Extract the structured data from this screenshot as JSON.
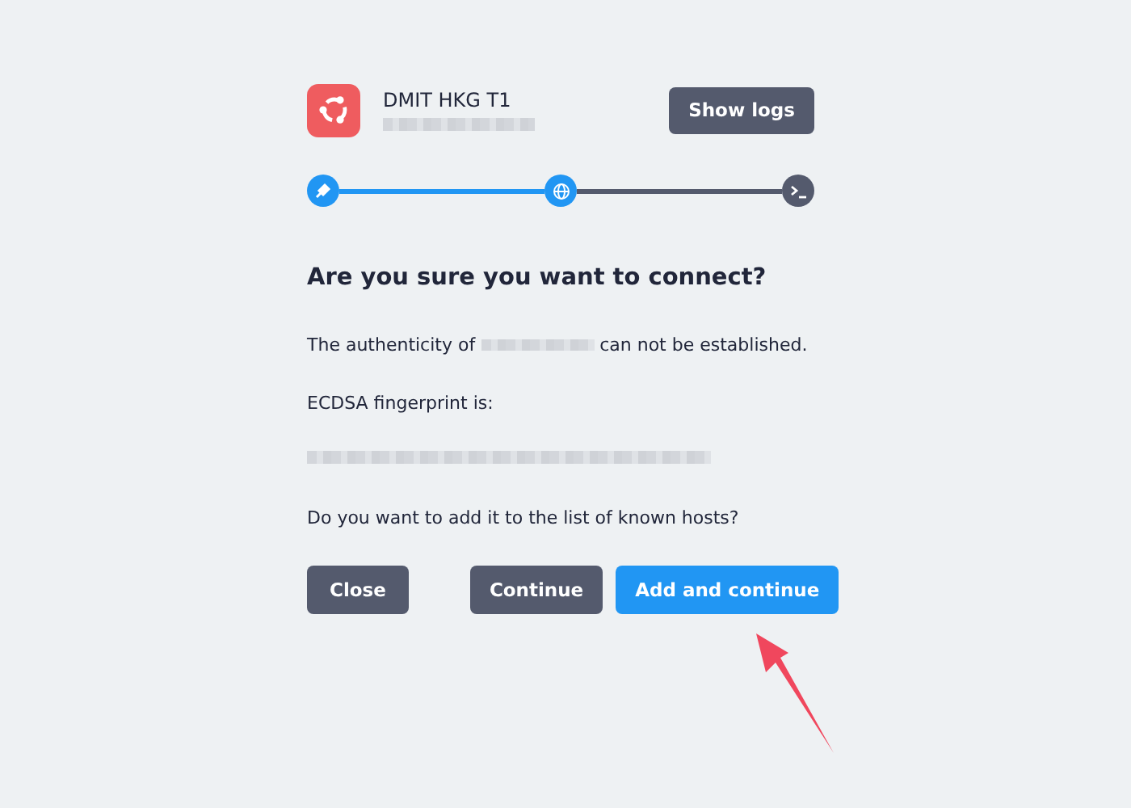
{
  "host": {
    "title": "DMIT HKG T1"
  },
  "show_logs_button": "Show logs",
  "steps": [
    {
      "kind": "plug",
      "done": true
    },
    {
      "kind": "globe",
      "done": true
    },
    {
      "kind": "terminal",
      "done": false
    }
  ],
  "heading": "Are you sure you want to connect?",
  "authenticity": {
    "before": "The authenticity of",
    "after": "can not be established."
  },
  "fingerprint_label": "ECDSA fingerprint is:",
  "question": "Do you want to add it to the list of known hosts?",
  "buttons": [
    {
      "label": "Close",
      "kind": "secondary"
    },
    {
      "label": "Continue",
      "kind": "secondary"
    },
    {
      "label": "Add and continue",
      "kind": "primary"
    }
  ]
}
